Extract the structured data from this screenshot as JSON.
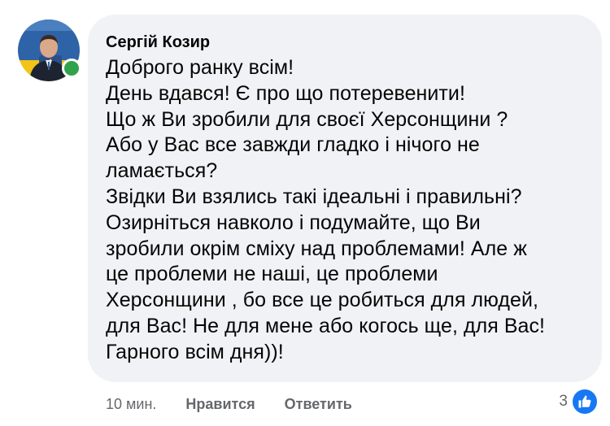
{
  "comment": {
    "author": "Сергій Козир",
    "text": "Доброго ранку всім!\nДень вдався! Є про що потеревенити!\nЩо ж Ви зробили для своєї Херсонщини ?\nАбо у Вас все завжди гладко і нічого не\nламається?\nЗвідки Ви взялись такі ідеальні і правильні?\nОзирніться навколо і подумайте, що Ви\nзробили окрім сміху над проблемами! Але ж\nце проблеми не наші, це проблеми\nХерсонщини , бо все це робиться для людей,\nдля Вас! Не для мене або когось ще, для Вас!\nГарного всім дня))!"
  },
  "actions": {
    "time": "10 мин.",
    "like": "Нравится",
    "reply": "Ответить"
  },
  "reactions": {
    "count": "3",
    "icon": "like-icon"
  },
  "colors": {
    "bubble": "#f0f2f5",
    "online": "#31a24c",
    "like": "#1877f2",
    "meta_text": "#65676b"
  }
}
